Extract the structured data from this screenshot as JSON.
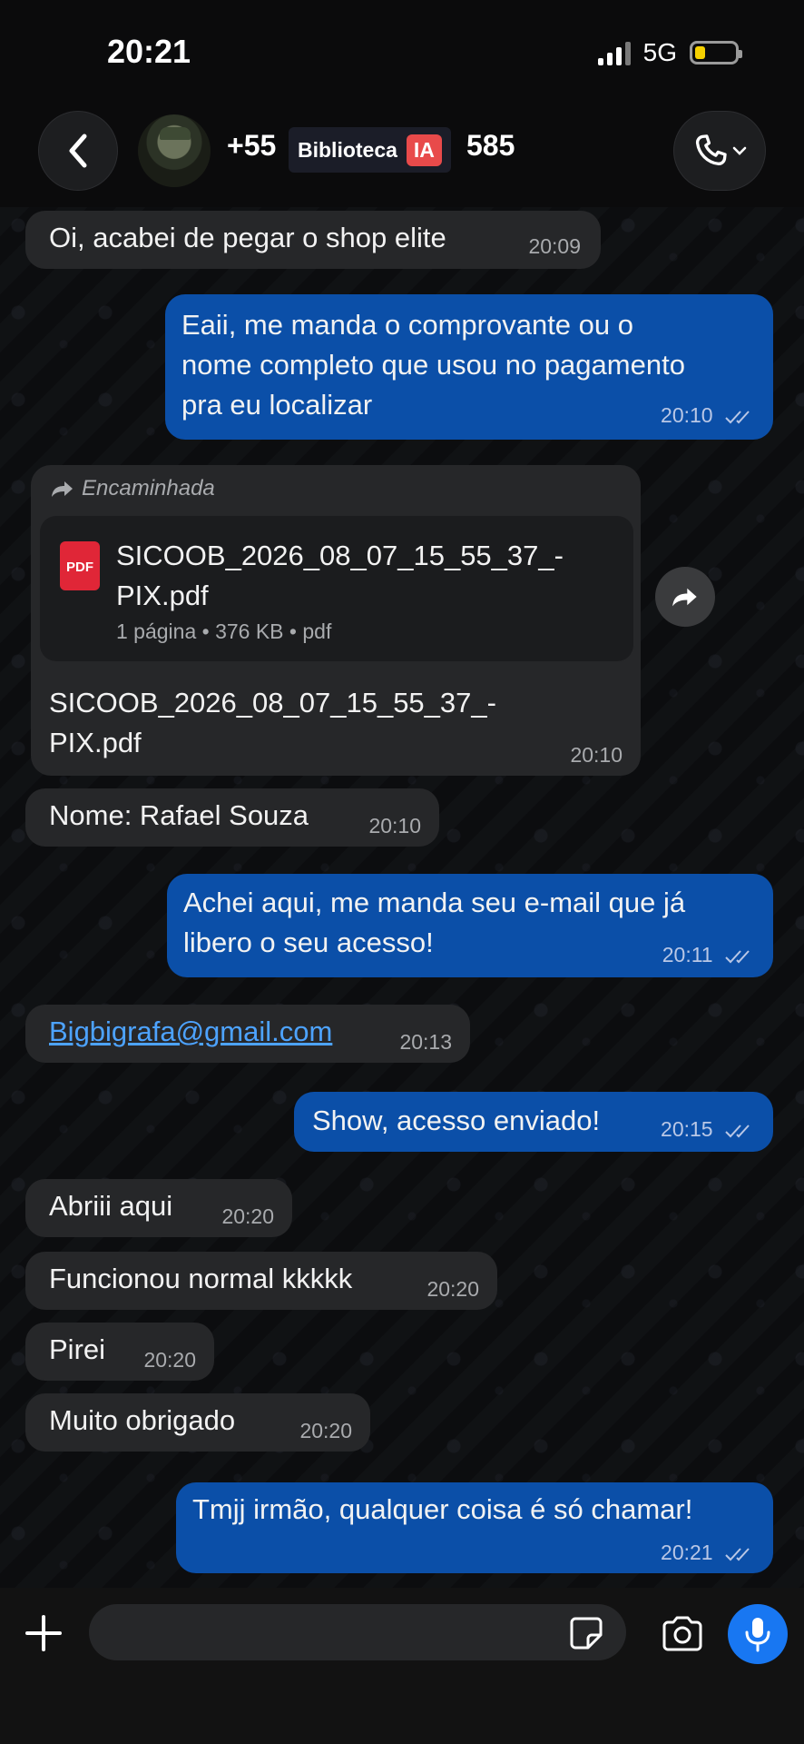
{
  "status_bar": {
    "time": "20:21",
    "network": "5G"
  },
  "header": {
    "contact_prefix": "+55",
    "contact_suffix": "585",
    "overlay_label": "Biblioteca",
    "overlay_tag": "IA"
  },
  "messages": [
    {
      "dir": "in",
      "text": "Oi, acabei de pegar o shop elite",
      "time": "20:09"
    },
    {
      "dir": "out",
      "text": "Eaii, me manda o comprovante ou o\nnome completo que usou no pagamento\npra eu localizar",
      "time": "20:10"
    },
    {
      "dir": "in",
      "type": "document",
      "forwarded_label": "Encaminhada",
      "doc_icon": "PDF",
      "file_name": "SICOOB_2026_08_07_15_55_37_-\nPIX.pdf",
      "file_meta": "1 página • 376 KB • pdf",
      "caption": "SICOOB_2026_08_07_15_55_37_-\nPIX.pdf",
      "time": "20:10"
    },
    {
      "dir": "in",
      "text": "Nome: Rafael Souza",
      "time": "20:10"
    },
    {
      "dir": "out",
      "text": "Achei aqui, me manda seu e-mail que já\nlibero o seu acesso!",
      "time": "20:11"
    },
    {
      "dir": "in",
      "text": "Bigbigrafa@gmail.com",
      "time": "20:13",
      "is_link": true
    },
    {
      "dir": "out",
      "text": "Show, acesso enviado!",
      "time": "20:15"
    },
    {
      "dir": "in",
      "text": "Abriii aqui",
      "time": "20:20"
    },
    {
      "dir": "in",
      "text": "Funcionou normal kkkkk",
      "time": "20:20"
    },
    {
      "dir": "in",
      "text": "Pirei",
      "time": "20:20"
    },
    {
      "dir": "in",
      "text": "Muito obrigado",
      "time": "20:20"
    },
    {
      "dir": "out",
      "text": "Tmjj irmão, qualquer coisa é só chamar!",
      "time": "20:21"
    }
  ],
  "input_bar": {
    "icons": [
      "plus-icon",
      "sticker-icon",
      "camera-icon",
      "microphone-icon"
    ],
    "message_value": ""
  },
  "colors": {
    "outgoing_bubble": "#0b4fa8",
    "incoming_bubble": "#262729",
    "link": "#4da3ff",
    "accent_blue": "#1877f2"
  }
}
